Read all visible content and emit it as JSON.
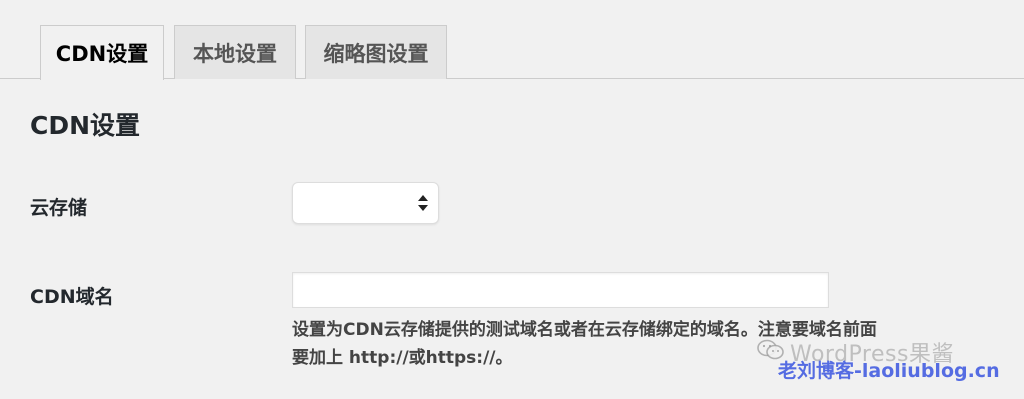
{
  "tabs": [
    {
      "label": "CDN设置",
      "active": true
    },
    {
      "label": "本地设置",
      "active": false
    },
    {
      "label": "缩略图设置",
      "active": false
    }
  ],
  "section": {
    "title": "CDN设置"
  },
  "fields": {
    "storage": {
      "label": "云存储",
      "selected_value": ""
    },
    "domain": {
      "label": "CDN域名",
      "value": "",
      "description_line1": "设置为CDN云存储提供的测试域名或者在云存储绑定的域名。注意要域名前面",
      "description_line2": "要加上 http://或https://。"
    }
  },
  "watermark": {
    "line1": "WordPress果酱",
    "line2": "老刘博客-laoliublog.cn",
    "icon": "wechat-icon"
  },
  "colors": {
    "background": "#f1f1f1",
    "tab_inactive": "#e5e5e5",
    "border": "#cccccc",
    "watermark_blue": "#3a55e0"
  }
}
